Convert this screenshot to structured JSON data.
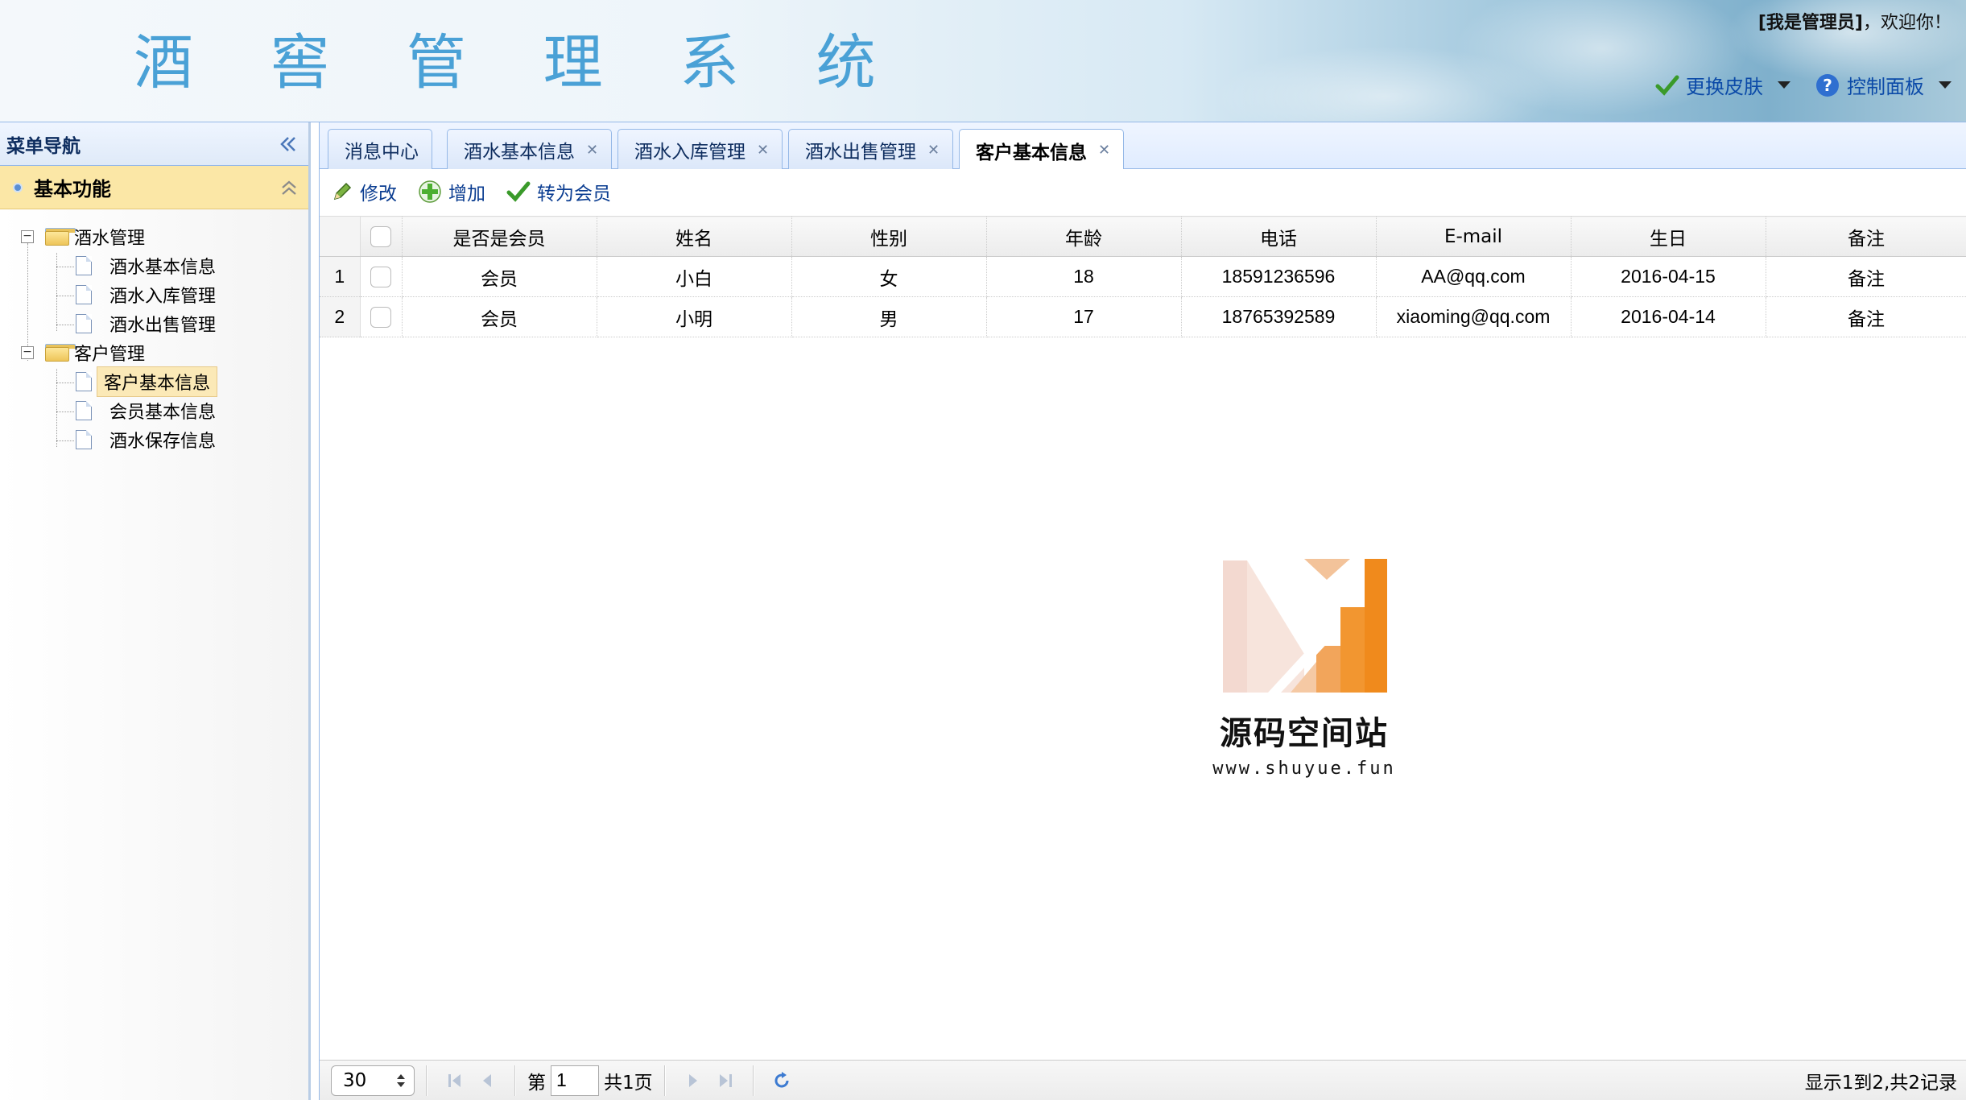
{
  "header": {
    "title": "酒 窖 管 理 系 统",
    "welcome_name": "[我是管理员]",
    "welcome_text": "，欢迎你！",
    "skin_menu": "更换皮肤",
    "control_menu": "控制面板"
  },
  "sidebar": {
    "title": "菜单导航",
    "section": "基本功能",
    "groups": [
      {
        "label": "酒水管理",
        "items": [
          "酒水基本信息",
          "酒水入库管理",
          "酒水出售管理"
        ]
      },
      {
        "label": "客户管理",
        "items": [
          "客户基本信息",
          "会员基本信息",
          "酒水保存信息"
        ]
      }
    ],
    "selected": "客户基本信息"
  },
  "tabs": [
    {
      "label": "消息中心",
      "closable": false
    },
    {
      "label": "酒水基本信息",
      "closable": true
    },
    {
      "label": "酒水入库管理",
      "closable": true
    },
    {
      "label": "酒水出售管理",
      "closable": true
    },
    {
      "label": "客户基本信息",
      "closable": true,
      "active": true
    }
  ],
  "toolbar": {
    "edit": "修改",
    "add": "增加",
    "to_member": "转为会员"
  },
  "grid": {
    "columns": [
      "是否是会员",
      "姓名",
      "性别",
      "年龄",
      "电话",
      "E-mail",
      "生日",
      "备注"
    ],
    "rows": [
      {
        "no": "1",
        "cells": [
          "会员",
          "小白",
          "女",
          "18",
          "18591236596",
          "AA@qq.com",
          "2016-04-15",
          "备注"
        ]
      },
      {
        "no": "2",
        "cells": [
          "会员",
          "小明",
          "男",
          "17",
          "18765392589",
          "xiaoming@qq.com",
          "2016-04-14",
          "备注"
        ]
      }
    ]
  },
  "watermark": {
    "name": "源码空间站",
    "url": "www.shuyue.fun"
  },
  "pager": {
    "page_size": "30",
    "page_prefix": "第",
    "page_value": "1",
    "page_total": "共1页",
    "info": "显示1到2,共2记录"
  },
  "colors": {
    "accent": "#4aa1d6",
    "selected_bg": "#fbe7a6",
    "border": "#95b8e7",
    "watermark_orange": "#f08a1c"
  }
}
